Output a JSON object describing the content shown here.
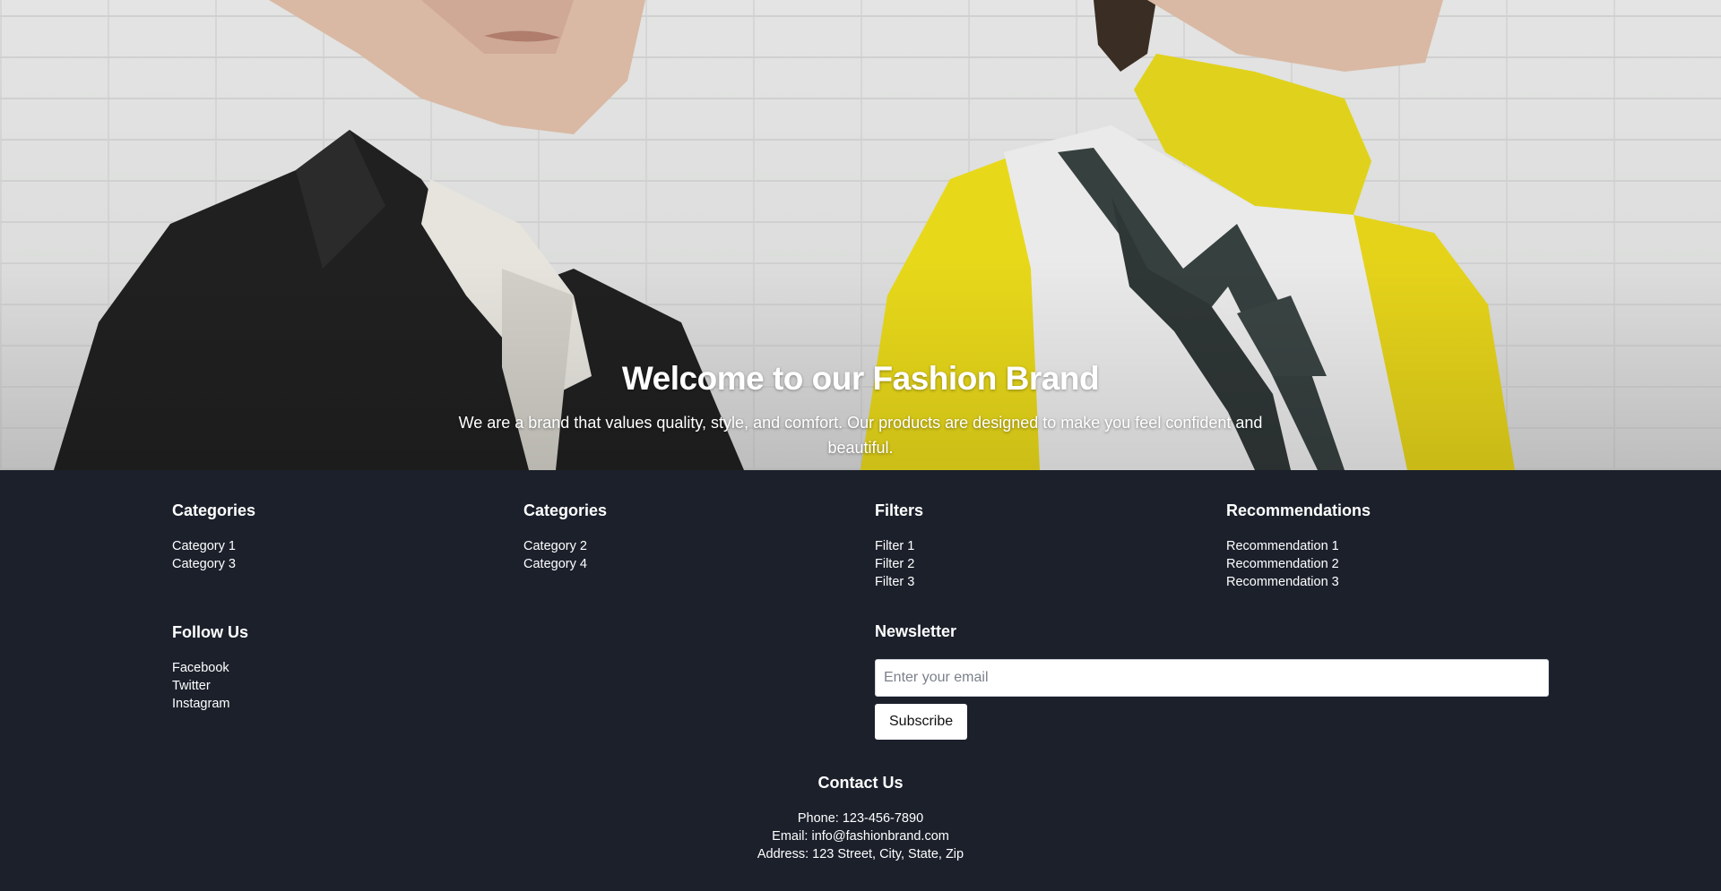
{
  "hero": {
    "title": "Welcome to our Fashion Brand",
    "subtitle": "We are a brand that values quality, style, and comfort. Our products are designed to make you feel confident and beautiful."
  },
  "footer": {
    "columns": [
      {
        "heading": "Categories",
        "items": [
          "Category 1",
          "Category 3"
        ]
      },
      {
        "heading": "Categories",
        "items": [
          "Category 2",
          "Category 4"
        ]
      },
      {
        "heading": "Filters",
        "items": [
          "Filter 1",
          "Filter 2",
          "Filter 3"
        ]
      },
      {
        "heading": "Recommendations",
        "items": [
          "Recommendation 1",
          "Recommendation 2",
          "Recommendation 3"
        ]
      }
    ],
    "follow": {
      "heading": "Follow Us",
      "items": [
        "Facebook",
        "Twitter",
        "Instagram"
      ]
    },
    "newsletter": {
      "heading": "Newsletter",
      "placeholder": "Enter your email",
      "button": "Subscribe"
    },
    "contact": {
      "heading": "Contact Us",
      "phone": "Phone: 123-456-7890",
      "email": "Email: info@fashionbrand.com",
      "address": "Address: 123 Street, City, State, Zip"
    }
  },
  "colors": {
    "footer_bg": "#1b202b",
    "accent_yellow": "#e8d81a",
    "text": "#ffffff"
  }
}
